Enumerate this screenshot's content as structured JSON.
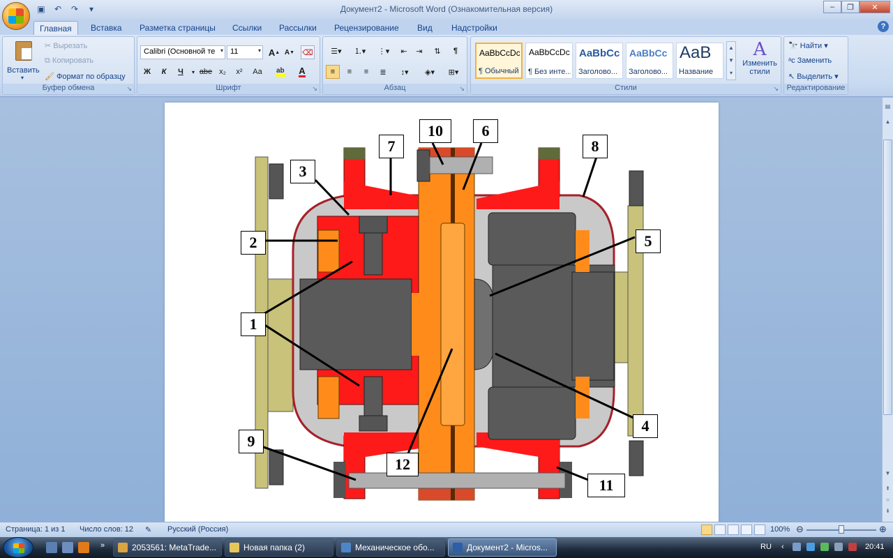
{
  "window": {
    "title": "Документ2 - Microsoft Word (Ознакомительная версия)"
  },
  "tabs": [
    "Главная",
    "Вставка",
    "Разметка страницы",
    "Ссылки",
    "Рассылки",
    "Рецензирование",
    "Вид",
    "Надстройки"
  ],
  "ribbon": {
    "clipboard": {
      "paste": "Вставить",
      "cut": "Вырезать",
      "copy": "Копировать",
      "format_painter": "Формат по образцу",
      "label": "Буфер обмена"
    },
    "font": {
      "font_name": "Calibri (Основной те",
      "font_size": "11",
      "bold": "Ж",
      "italic": "К",
      "underline": "Ч",
      "strike": "abe",
      "subscript": "x₂",
      "superscript": "x²",
      "case": "Aa",
      "grow": "A",
      "shrink": "A",
      "label": "Шрифт"
    },
    "paragraph": {
      "label": "Абзац"
    },
    "styles": {
      "items": [
        {
          "sample": "AaBbCcDc",
          "name": "¶ Обычный"
        },
        {
          "sample": "AaBbCcDc",
          "name": "¶ Без инте..."
        },
        {
          "sample": "AaBbCc",
          "name": "Заголово..."
        },
        {
          "sample": "AaBbCc",
          "name": "Заголово..."
        },
        {
          "sample": "AaB",
          "name": "Название"
        }
      ],
      "change": "Изменить стили",
      "label": "Стили"
    },
    "editing": {
      "find": "Найти",
      "replace": "Заменить",
      "select": "Выделить",
      "label": "Редактирование"
    }
  },
  "diagram": {
    "callouts": [
      "1",
      "2",
      "3",
      "4",
      "5",
      "6",
      "7",
      "8",
      "9",
      "10",
      "11",
      "12"
    ]
  },
  "statusbar": {
    "page": "Страница: 1 из 1",
    "words": "Число слов: 12",
    "language": "Русский (Россия)",
    "zoom": "100%"
  },
  "taskbar": {
    "items": [
      {
        "label": "2053561: MetaTrade...",
        "color": "#d9a441"
      },
      {
        "label": "Новая папка (2)",
        "color": "#e8c75a"
      },
      {
        "label": "Механическое обо...",
        "color": "#4d86c8"
      },
      {
        "label": "Документ2 - Micros...",
        "color": "#2b5fa8"
      }
    ],
    "lang": "RU",
    "time": "20:41"
  }
}
